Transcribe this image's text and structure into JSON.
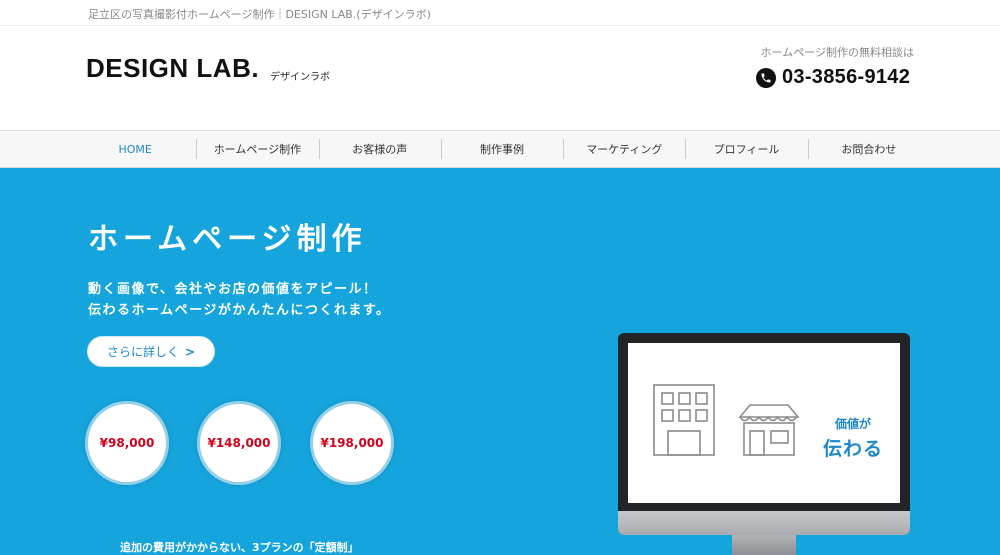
{
  "topbar": {
    "tagline": "足立区の写真撮影付ホームページ制作｜DESIGN LAB.(デザインラボ)"
  },
  "header": {
    "logo": "DESIGN LAB.",
    "logo_sub": "デザインラボ",
    "contact_label": "ホームページ制作の無料相談は",
    "phone": "03-3856-9142",
    "phone_icon": "phone-icon"
  },
  "nav": {
    "items": [
      {
        "label": "HOME",
        "active": true
      },
      {
        "label": "ホームページ制作"
      },
      {
        "label": "お客様の声"
      },
      {
        "label": "制作事例"
      },
      {
        "label": "マーケティング"
      },
      {
        "label": "プロフィール"
      },
      {
        "label": "お問合わせ"
      }
    ]
  },
  "hero": {
    "title": "ホームページ制作",
    "lead_line1": "動く画像で、会社やお店の価値をアピール！",
    "lead_line2": "伝わるホームページがかんたんにつくれます。",
    "more_label": "さらに詳しく",
    "more_arrow": ">",
    "prices": [
      "¥98,000",
      "¥148,000",
      "¥198,000"
    ],
    "note": "追加の費用がかからない、3プランの「定額制」",
    "monitor": {
      "text_top": "価値が",
      "text_main": "伝わる"
    }
  },
  "colors": {
    "hero_bg": "#15a4dc",
    "accent": "#1e88c8",
    "price": "#d0021b"
  }
}
